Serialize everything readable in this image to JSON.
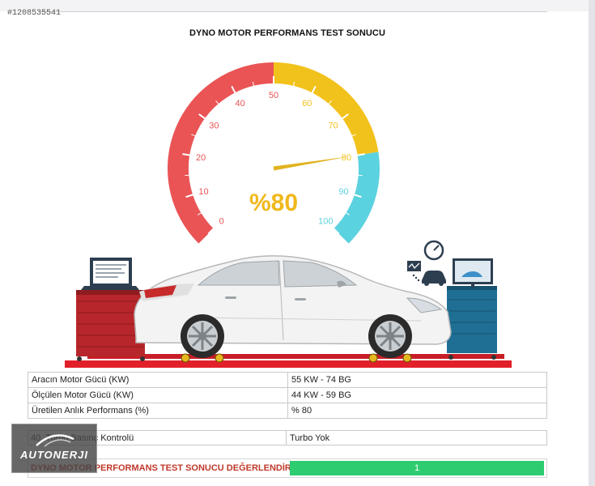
{
  "listing_id": "#1208535541",
  "title": "DYNO MOTOR PERFORMANS TEST SONUCU",
  "gauge": {
    "tick_labels": [
      "0",
      "10",
      "20",
      "30",
      "40",
      "50",
      "60",
      "70",
      "80",
      "90",
      "100"
    ],
    "reading_text": "%80",
    "value_percent": 80,
    "colors": {
      "low": "#ea5455",
      "mid": "#f2c21c",
      "high": "#5bd2df",
      "needle": "#e1b320",
      "reading": "#f0b81b"
    }
  },
  "illustration": {
    "car": "white sedan on dyno rollers",
    "left_station": "red tool cabinet with laptop",
    "right_station": "blue cabinet with monitor",
    "icons": [
      "speedometer-icon",
      "diagnostic-screen-icon",
      "car-icon"
    ]
  },
  "specs": [
    {
      "label": "Aracın Motor Gücü (KW)",
      "value": "55 KW - 74 BG"
    },
    {
      "label": "Ölçülen Motor Gücü (KW)",
      "value": "44 KW - 59 BG"
    },
    {
      "label": "Üretilen Anlık Performans (%)",
      "value": "% 80"
    }
  ],
  "turbo": {
    "label": "40. Turbo Basınç Kontrolü",
    "value": "Turbo Yok"
  },
  "evaluation": {
    "label": "DYNO MOTOR PERFORMANS TEST SONUCU DEĞERLENDİRME",
    "value": "1",
    "color": "#2ecc71"
  },
  "logo": {
    "text": "AUTONERJI"
  }
}
